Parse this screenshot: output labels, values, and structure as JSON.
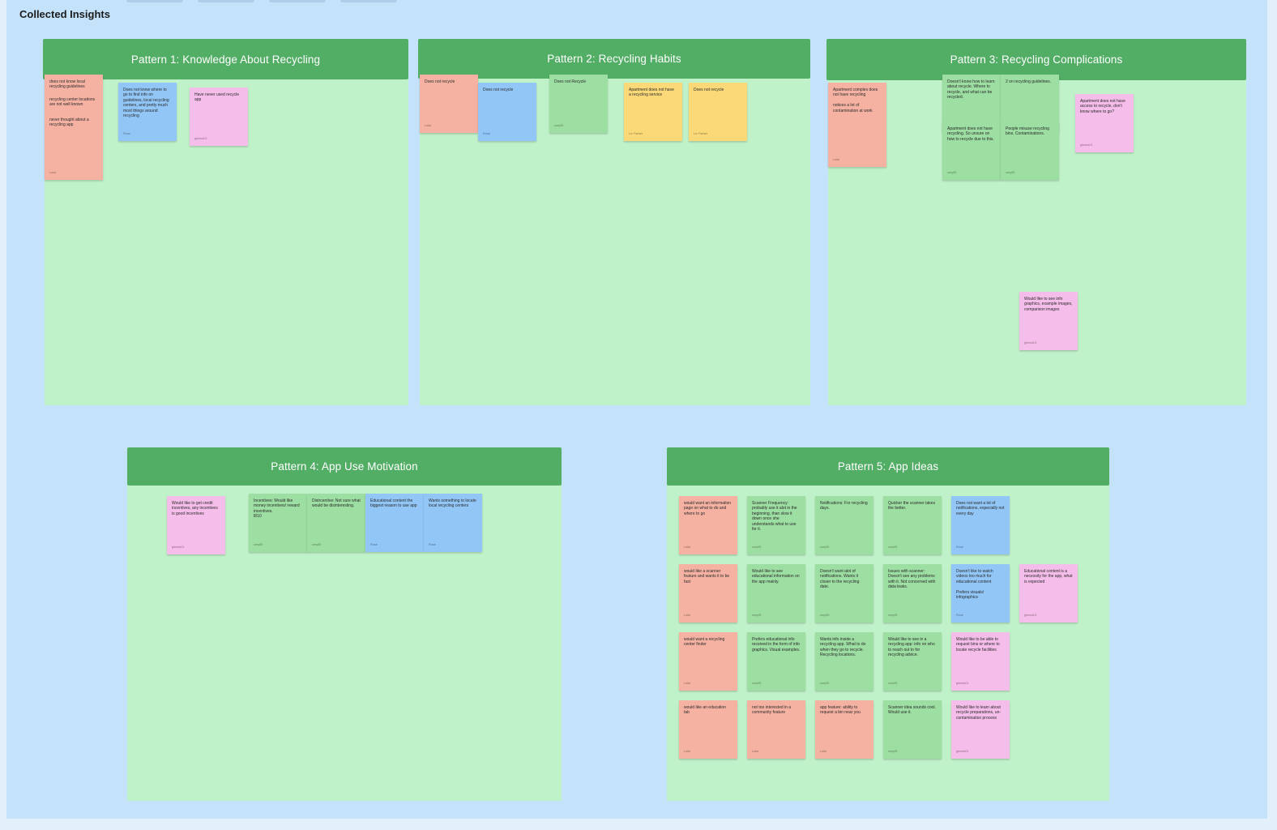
{
  "board": {
    "title": "Collected Insights"
  },
  "sections": [
    {
      "title": "Pattern 1: Knowledge About Recycling"
    },
    {
      "title": "Pattern 2: Recycling Habits"
    },
    {
      "title": "Pattern 3: Recycling Complications"
    },
    {
      "title": "Pattern 4: App Use Motivation"
    },
    {
      "title": "Pattern 5: App Ideas"
    }
  ],
  "notes": {
    "p1": [
      {
        "text": "does not know local recycling guidelines",
        "author": ""
      },
      {
        "text": "recycling center locations are not well known",
        "author": ""
      },
      {
        "text": "never thought about a recycling app",
        "author": "Luke"
      },
      {
        "text": "Does not know where to go to find info on guidelines, local recycling centers, and pretty much most things around recycling",
        "author": "Rose"
      },
      {
        "text": "Have never used recycle app",
        "author": "glenna01"
      }
    ],
    "p2": [
      {
        "text": "Does not recycle",
        "author": "Luke"
      },
      {
        "text": "Does not recycle",
        "author": "Rose"
      },
      {
        "text": "Does not Recycle",
        "author": "crey05"
      },
      {
        "text": "Apartment does not have a recycling service",
        "author": "Liz Farber"
      },
      {
        "text": "Does not recycle",
        "author": "Liz Farber"
      }
    ],
    "p3": [
      {
        "text": "Apartment complex does not have recycling\n\nnotices a lot of contamination at work",
        "author": "Luke"
      },
      {
        "text": "Doesn't know how to learn about recycle. Where to recycle, and what can be recycled.",
        "author": ""
      },
      {
        "text": "2 on recycling guidelines.",
        "author": ""
      },
      {
        "text": "Apartment does not have recycling. So unsure on how to recycle due to this.",
        "author": "crey05"
      },
      {
        "text": "People misuse recycling bins. Contaminations.",
        "author": "crey05"
      },
      {
        "text": "Apartment does not have access to recycle, don't know where to go?",
        "author": "glenna01"
      }
    ],
    "p4": [
      {
        "text": "Would like to get credit incentives, any incentives is good incentives",
        "author": "glenna01"
      },
      {
        "text": "Incentives: Would like money incentives/ reward incentives.\n8/10",
        "author": "crey05"
      },
      {
        "text": "Distrcentive: Not sure what would be disinteresting.",
        "author": "crey05"
      },
      {
        "text": "Educational content the biggest reason to use app",
        "author": "Rose"
      },
      {
        "text": "Wants something to locate local recycling centers",
        "author": "Rose"
      }
    ],
    "p5": [
      {
        "text": "would want an information page on what to do and where to go",
        "author": "Luke"
      },
      {
        "text": "Scanner Frequency: probably use it alot in the beginning, than slow it down once she understands what to use for it.",
        "author": "crey05"
      },
      {
        "text": "Notifications: For recycling days.",
        "author": "crey05"
      },
      {
        "text": "Quicker the scanner takes the better.",
        "author": "crey05"
      },
      {
        "text": "Does not want a lot of notifications, especially not every day",
        "author": "Rose"
      },
      {
        "text": "Would like to see info graphics, example images, comparison images",
        "author": "glenna01"
      },
      {
        "text": "would like a scanner feature and wants it to be fast",
        "author": "Luke"
      },
      {
        "text": "Would like to see educational information on the app mainly.",
        "author": "crey05"
      },
      {
        "text": "Doesn't want alot of notifications. Wants it closer to the recycling date.",
        "author": "crey05"
      },
      {
        "text": "Issues with scanner: Doesn't see any problems with it. Not concerned with data leaks.",
        "author": "crey05"
      },
      {
        "text": "Doesn't like to watch videos too much for educational content\n\nPrefers visuals/ infographics",
        "author": "Rose"
      },
      {
        "text": "Educational content is a necessity for the app, what is expected",
        "author": "glenna01"
      },
      {
        "text": "would want a recycling center finder",
        "author": "Luke"
      },
      {
        "text": "Prefers educational info received in the form of info graphics. Visual examples.",
        "author": "crey05"
      },
      {
        "text": "Wants info inside a recycling app. What to do when they go to recycle. Recycling locations.",
        "author": "crey05"
      },
      {
        "text": "Would like to see in a recycling app: info on who to reach out to for recycling advice.",
        "author": "crey05"
      },
      {
        "text": "Would like to be able to request bins or where to locate recycle facilities",
        "author": "glenna01"
      },
      {
        "text": "would like an education tab",
        "author": "Luke"
      },
      {
        "text": "not too interested in a community feature",
        "author": "Luke"
      },
      {
        "text": "app feature: ability to request a bin near you",
        "author": "Luke"
      },
      {
        "text": "Scanner idea sounds cool. Would use it.",
        "author": "crey05"
      },
      {
        "text": "Would like to learn about recycle preparations, un-contamination process",
        "author": "glenna01"
      }
    ]
  },
  "colors": {
    "board_bg": "#c5e2fb",
    "section_bg": "#c0f2c9",
    "section_header": "#52ad65",
    "note_salmon": "#f5b2a2",
    "note_blue": "#91c6f7",
    "note_green": "#9ddea2",
    "note_pink": "#f5bde9",
    "note_yellow": "#fbd978"
  }
}
